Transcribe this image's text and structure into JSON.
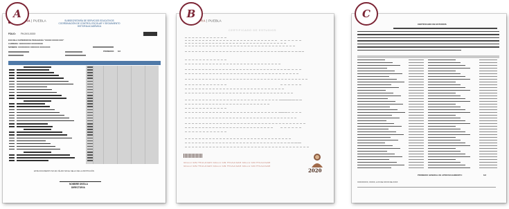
{
  "documents": [
    {
      "badge": "A",
      "logo": "CULTURA",
      "logo_sub": "| PUEBLA",
      "header_lines": [
        "SUBSECRETARÍA DE SERVICIOS EDUCATIVOS",
        "COORDINACIÓN DE CONTROL ESCOLAR Y SEGUIMIENTO",
        "HISTORIA ACADÉMICA"
      ],
      "folio_label": "FOLIO:",
      "folio_value": "FH-XXX-XXXX",
      "fields": [
        "ESCUELA SUPERIOR DE PEDAGOGÍA \"XXXXX XXXXX XXX\"",
        "CARRERA: XXXXXXXXX XXXXXXXXX",
        "NOMBRE: XXXXXXXXX XXXXXXX XXXXXXXX"
      ],
      "promedio_label": "PROMEDIO:",
      "promedio_value": "8.8",
      "footer_note": "ESTE DOCUMENTO NO ES VÁLIDO SIN EL SELLO DE LA INSTITUCIÓN",
      "signature_name": "NOMBRE DE/DLA",
      "signature_title": "DIRECTOR/A"
    },
    {
      "badge": "B",
      "logo": "CULTURA",
      "logo_sub": "| PUEBLA",
      "title": "CERTIFICADO DE ESTUDIOS",
      "year": "2020",
      "stamp": "SELLO SIN PROCESAR SELLO SIN PROCESAR SELLO SIN PROCESAR"
    },
    {
      "badge": "C",
      "title": "CERTIFICADO DE ESTUDIOS",
      "grade_label": "PROMEDIO GENERAL DE APROVECHAMIENTO:",
      "grade_value": "8.8",
      "place_date": "XXXXXXXXX, XXXXX, A XX DE XXXXX DE XXXX"
    }
  ]
}
